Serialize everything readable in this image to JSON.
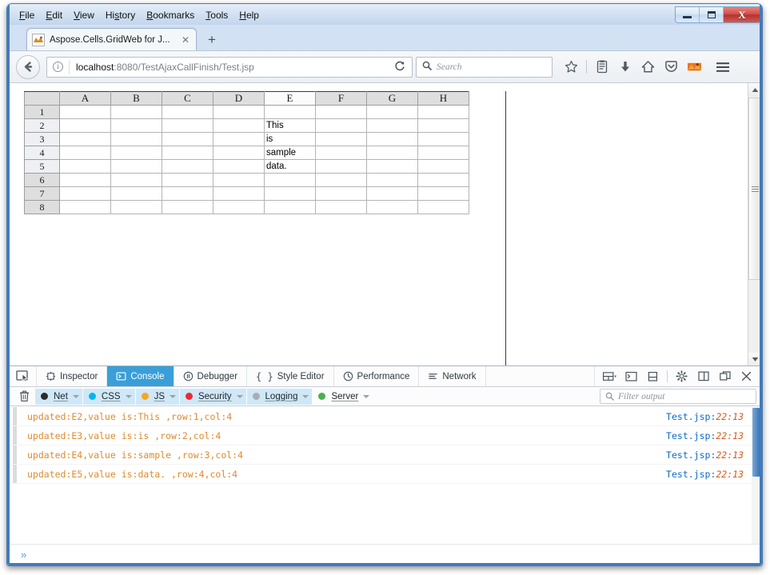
{
  "window": {
    "minimize_label": "Minimize",
    "maximize_label": "Maximize",
    "close_label": "X"
  },
  "menubar": {
    "items": [
      {
        "label": "File"
      },
      {
        "label": "Edit"
      },
      {
        "label": "View"
      },
      {
        "label": "History"
      },
      {
        "label": "Bookmarks"
      },
      {
        "label": "Tools"
      },
      {
        "label": "Help"
      }
    ]
  },
  "tabs": {
    "items": [
      {
        "title": "Aspose.Cells.GridWeb for J...",
        "close_label": "✕",
        "favicon": "aspose-favicon"
      }
    ],
    "new_tab_label": "+"
  },
  "navbar": {
    "back_icon": "back-arrow-icon",
    "identity_icon": "info-icon",
    "url_host": "localhost",
    "url_rest": ":8080/TestAjaxCallFinish/Test.jsp",
    "reload_label": "⟳",
    "search_placeholder": "Search",
    "icons": [
      {
        "name": "bookmark-star-icon"
      },
      {
        "name": "library-icon"
      },
      {
        "name": "download-icon"
      },
      {
        "name": "home-icon"
      },
      {
        "name": "pocket-icon"
      },
      {
        "name": "firefox-account-icon"
      }
    ],
    "menu_icon": "hamburger-menu-icon"
  },
  "grid": {
    "columns": [
      "A",
      "B",
      "C",
      "D",
      "E",
      "F",
      "G",
      "H"
    ],
    "selected_column": "E",
    "rows": [
      "1",
      "2",
      "3",
      "4",
      "5",
      "6",
      "7",
      "8"
    ],
    "selected_rows": [
      "2",
      "3",
      "4",
      "5"
    ],
    "cells": [
      {
        "row": "2",
        "col": "E",
        "value": "This"
      },
      {
        "row": "3",
        "col": "E",
        "value": "is"
      },
      {
        "row": "4",
        "col": "E",
        "value": "sample"
      },
      {
        "row": "5",
        "col": "E",
        "value": "data."
      }
    ]
  },
  "devtools": {
    "picker_icon": "element-picker-icon",
    "tabs": [
      {
        "label": "Inspector",
        "icon": "inspector-icon",
        "active": false
      },
      {
        "label": "Console",
        "icon": "console-icon",
        "active": true
      },
      {
        "label": "Debugger",
        "icon": "debugger-icon",
        "active": false
      },
      {
        "label": "Style Editor",
        "icon": "style-editor-icon",
        "active": false
      },
      {
        "label": "Performance",
        "icon": "performance-icon",
        "active": false
      },
      {
        "label": "Network",
        "icon": "network-icon",
        "active": false
      }
    ],
    "tools": [
      {
        "name": "responsive-design-mode-icon"
      },
      {
        "name": "split-console-icon"
      },
      {
        "name": "dock-bottom-icon"
      },
      {
        "name": "settings-gear-icon"
      },
      {
        "name": "dock-side-icon"
      },
      {
        "name": "separate-window-icon"
      },
      {
        "name": "close-devtools-icon"
      }
    ],
    "trash_icon": "clear-console-icon",
    "filters": [
      {
        "label": "Net",
        "color": "#2b2b2b",
        "active": true
      },
      {
        "label": "CSS",
        "color": "#00b6f0",
        "active": true
      },
      {
        "label": "JS",
        "color": "#f5a623",
        "active": true
      },
      {
        "label": "Security",
        "color": "#ed2939",
        "active": true
      },
      {
        "label": "Logging",
        "color": "#a8aeb4",
        "active": true
      },
      {
        "label": "Server",
        "color": "#4caf50",
        "active": false
      }
    ],
    "filter_placeholder": "Filter output",
    "filter_search_icon": "search-icon",
    "console_messages": [
      {
        "text": "updated:E2,value is:This ,row:1,col:4",
        "source": "Test.jsp",
        "location": "22:13"
      },
      {
        "text": "updated:E3,value is:is ,row:2,col:4",
        "source": "Test.jsp",
        "location": "22:13"
      },
      {
        "text": "updated:E4,value is:sample ,row:3,col:4",
        "source": "Test.jsp",
        "location": "22:13"
      },
      {
        "text": "updated:E5,value is:data. ,row:4,col:4",
        "source": "Test.jsp",
        "location": "22:13"
      }
    ],
    "prompt_label": "»"
  },
  "colors": {
    "accent": "#3a9fd8",
    "log_text": "#e08a2e",
    "source_link": "#0b6bcb",
    "source_line": "#d85a1a",
    "window_border": "#3f7bbf"
  }
}
